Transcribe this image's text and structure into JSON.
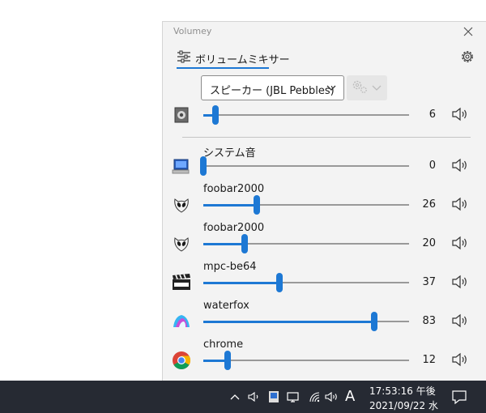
{
  "app": {
    "title": "Volumey"
  },
  "tab": {
    "label": "ボリュームミキサー"
  },
  "device": {
    "name": "スピーカー (JBL Pebbles)",
    "volume": 6
  },
  "sessions": [
    {
      "name": "システム音",
      "volume": 0,
      "icon": "system-sounds-icon"
    },
    {
      "name": "foobar2000",
      "volume": 26,
      "icon": "foobar2000-icon"
    },
    {
      "name": "foobar2000",
      "volume": 20,
      "icon": "foobar2000-icon"
    },
    {
      "name": "mpc-be64",
      "volume": 37,
      "icon": "mpc-be-icon"
    },
    {
      "name": "waterfox",
      "volume": 83,
      "icon": "waterfox-icon"
    },
    {
      "name": "chrome",
      "volume": 12,
      "icon": "chrome-icon"
    }
  ],
  "taskbar": {
    "ime_indicator": "A",
    "time": "17:53:16 午後",
    "date": "2021/09/22 水"
  },
  "colors": {
    "accent": "#1d78d4",
    "taskbar": "#262a33",
    "panel": "#f3f3f3"
  }
}
